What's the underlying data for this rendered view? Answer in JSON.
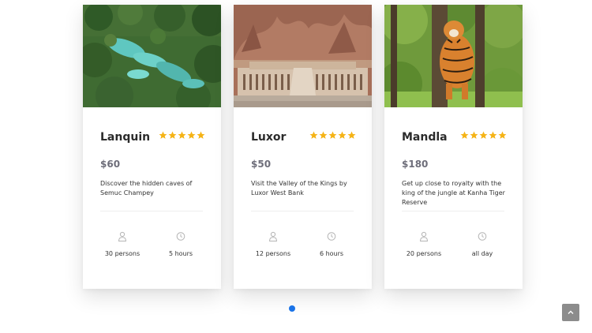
{
  "colors": {
    "star": "#f5b316",
    "accent_dot": "#1a73e8",
    "scroll_button": "#8c8c8c",
    "price": "#6e6e7a"
  },
  "tours": [
    {
      "title": "Lanquin",
      "rating": 5,
      "price": "$60",
      "description": "Discover the hidden caves of Semuc Champey",
      "persons": "30 persons",
      "duration": "5 hours",
      "image_icon": "jungle-pools-photo"
    },
    {
      "title": "Luxor",
      "rating": 5,
      "price": "$50",
      "description": "Visit the Valley of the Kings by Luxor West Bank",
      "persons": "12 persons",
      "duration": "6 hours",
      "image_icon": "temple-photo"
    },
    {
      "title": "Mandla",
      "rating": 5,
      "price": "$180",
      "description": "Get up close to royalty with the king of the jungle at Kanha Tiger Reserve",
      "persons": "20 persons",
      "duration": "all day",
      "image_icon": "tiger-photo"
    }
  ],
  "carousel": {
    "active_page": 1,
    "page_count": 1
  },
  "icons": {
    "persons": "user-icon",
    "duration": "clock-icon",
    "scroll_top": "chevron-up-icon"
  }
}
